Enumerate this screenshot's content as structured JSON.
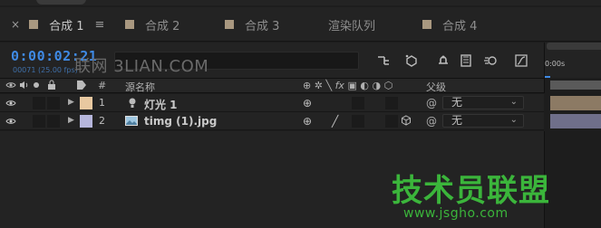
{
  "tabs": [
    {
      "label": "合成 1",
      "active": true,
      "close": "×",
      "menu": "≡"
    },
    {
      "label": "合成 2"
    },
    {
      "label": "合成 3"
    },
    {
      "label": "渲染队列"
    },
    {
      "label": "合成 4"
    }
  ],
  "timeline": {
    "timecode": "0:00:02:21",
    "framecount": "00071 (25.00 fps)",
    "watermark": "联网 3LIAN.COM",
    "ruler_label": "0:00s"
  },
  "header": {
    "number_col": "#",
    "source_name_col": "源名称",
    "parent_col": "父级"
  },
  "layers": [
    {
      "num": "1",
      "name": "灯光 1",
      "parent": "无",
      "label_color": "#e8c8a0",
      "track_color": "#8c7a64"
    },
    {
      "num": "2",
      "name": "timg (1).jpg",
      "parent": "无",
      "label_color": "#b6b6dc",
      "track_color": "#6f6f8a"
    }
  ],
  "brand": {
    "name": "技术员联盟",
    "url": "www.jsgho.com"
  },
  "colors": {
    "accent": "#3f8ae5",
    "brand": "#3bb53b"
  }
}
